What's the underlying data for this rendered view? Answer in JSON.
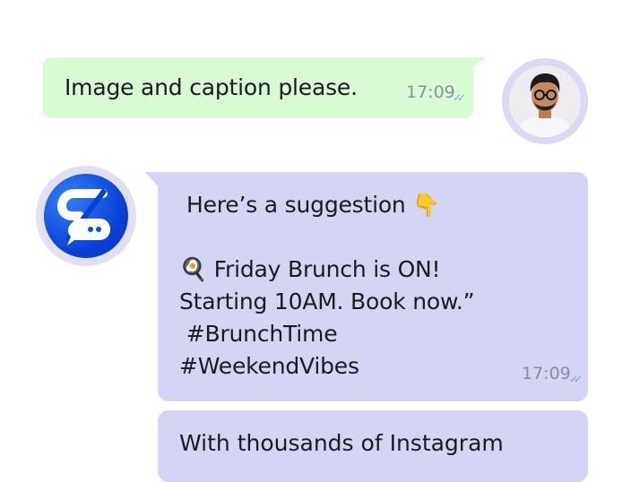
{
  "messages": {
    "outgoing": {
      "text": "Image and caption please.",
      "time": "17:09",
      "status_icon": "double-check-icon"
    },
    "incoming": {
      "lines": [
        "Here’s a suggestion 👇",
        "🍳 Friday Brunch is ON!",
        "Starting 10AM. Book now.”",
        " #BrunchTime",
        "#WeekendVibes"
      ],
      "time": "17:09",
      "status_icon": "double-check-icon"
    },
    "incoming_2": {
      "text": "With thousands of Instagram"
    }
  },
  "colors": {
    "outgoing_bubble": "#d9fbd3",
    "incoming_bubble": "#d4d4f4",
    "accent_blue": "#0a4fe0",
    "tick_blue": "#6ba5ea"
  },
  "icons": {
    "user": "user-avatar",
    "bot": "chat-brand-logo-icon"
  }
}
